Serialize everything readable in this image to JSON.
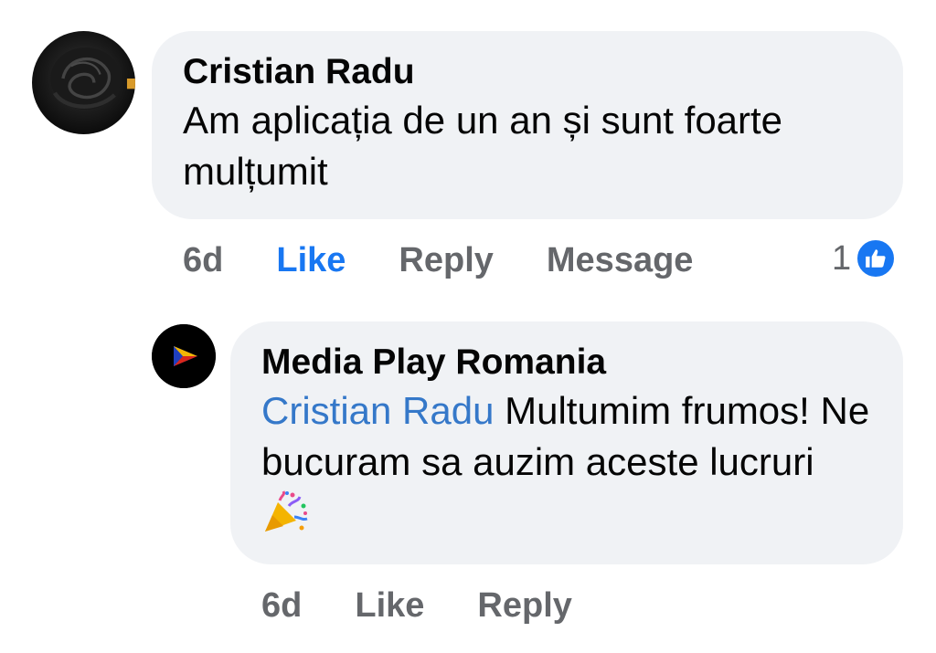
{
  "comment": {
    "author": "Cristian Radu",
    "text": "Am aplicația de un an și sunt foarte mulțumit",
    "time": "6d",
    "like_label": "Like",
    "reply_label": "Reply",
    "message_label": "Message",
    "reaction_count": "1",
    "reaction_icon": "thumbs-up-icon",
    "avatar_icon": "black-rose-avatar",
    "like_color": "#1877f2"
  },
  "reply": {
    "author": "Media Play Romania",
    "mention": "Cristian Radu",
    "text": "Multumim frumos! Ne bucuram sa auzim aceste lucruri",
    "emoji": "party-popper-icon",
    "time": "6d",
    "like_label": "Like",
    "reply_label": "Reply",
    "avatar_icon": "play-logo-avatar"
  },
  "colors": {
    "bubble_bg": "#f0f2f5",
    "muted_text": "#65676b",
    "mention": "#3578c9"
  }
}
